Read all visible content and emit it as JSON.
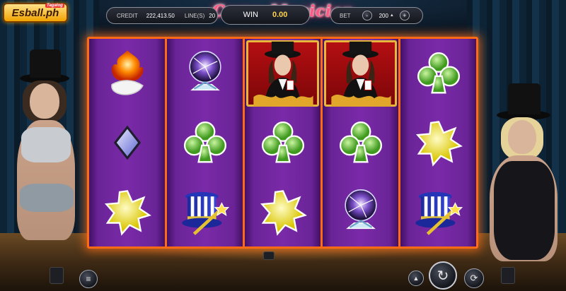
{
  "brand": {
    "logo_text": "Esball.ph",
    "logo_tag": "Tagalog"
  },
  "game": {
    "title": "Curvy Magician"
  },
  "reels": [
    [
      "fire-hand",
      "diamond",
      "star"
    ],
    [
      "plasma-ball",
      "club",
      "magic-hat"
    ],
    [
      "magician-wild",
      "club",
      "star"
    ],
    [
      "magician-wild",
      "club",
      "plasma-ball"
    ],
    [
      "club",
      "star",
      "magic-hat"
    ]
  ],
  "bottom_bar": {
    "credit_label": "CREDIT",
    "credit_value": "222,413.50",
    "lines_label": "LINE(S)",
    "lines_value": "20",
    "win_label": "WIN",
    "win_value": "0.00",
    "bet_label": "BET",
    "bet_minus": "-",
    "bet_value": "200",
    "bet_plus": "+",
    "menu_icon": "≡",
    "spin_icon": "↻",
    "auto_icon": "⟳",
    "maxbet_icon": "▲"
  },
  "colors": {
    "frame": "#ff6a14",
    "reel": "#6a2497",
    "title": "#ff5a86",
    "win_value": "#ffd24a"
  }
}
